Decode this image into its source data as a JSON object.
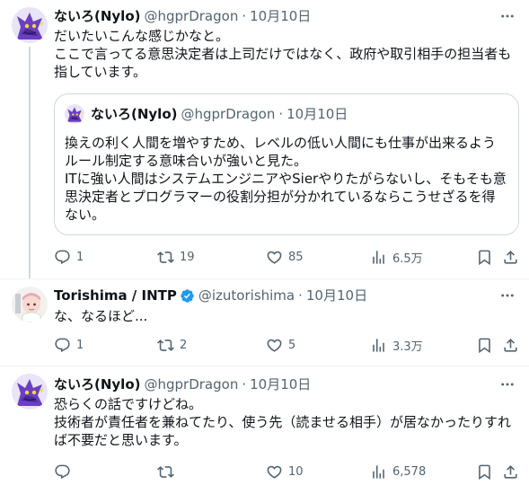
{
  "tweets": [
    {
      "name": "ないろ(Nylo)",
      "handle": "@hgprDragon",
      "date": "10月10日",
      "lines": [
        "だいたいこんな感じかなと。",
        "ここで言ってる意思決定者は上司だけではなく、政府や取引相手の担当者も",
        "指しています。"
      ],
      "quote": {
        "name": "ないろ(Nylo)",
        "handle": "@hgprDragon",
        "date": "10月10日",
        "lines": [
          "換えの利く人間を増やすため、レベルの低い人間にも仕事が出来るよう",
          "ルール制定する意味合いが強いと見た。",
          "ITに強い人間はシステムエンジニアやSierやりたがらないし、そもそも意",
          "思決定者とプログラマーの役割分担が分かれているならこうせざるを得",
          "ない。"
        ]
      },
      "actions": {
        "replies": "1",
        "reposts": "19",
        "likes": "85",
        "views": "6.5万"
      }
    },
    {
      "name": "Torishima / INTP",
      "handle": "@izutorishima",
      "date": "10月10日",
      "lines": [
        "な、なるほど..."
      ],
      "actions": {
        "replies": "1",
        "reposts": "2",
        "likes": "5",
        "views": "3.3万"
      }
    },
    {
      "name": "ないろ(Nylo)",
      "handle": "@hgprDragon",
      "date": "10月10日",
      "lines": [
        "恐らくの話ですけどね。",
        "技術者が責任者を兼ねてたり、使う先（読ませる相手）が居なかったりすれ",
        "ば不要だと思います。"
      ],
      "actions": {
        "replies": "",
        "reposts": "",
        "likes": "10",
        "views": "6,578"
      }
    }
  ],
  "icons": {
    "more": "more-horizontal-icon",
    "reply": "reply-icon",
    "repost": "repost-icon",
    "like": "heart-icon",
    "views": "views-chart-icon",
    "bookmark": "bookmark-icon",
    "share": "share-icon",
    "verified": "verified-badge-icon"
  },
  "colors": {
    "text": "#0f1419",
    "secondary": "#536471",
    "border": "#cfd9de",
    "verified": "#1d9bf0",
    "dragon": "#6b3fc4"
  }
}
